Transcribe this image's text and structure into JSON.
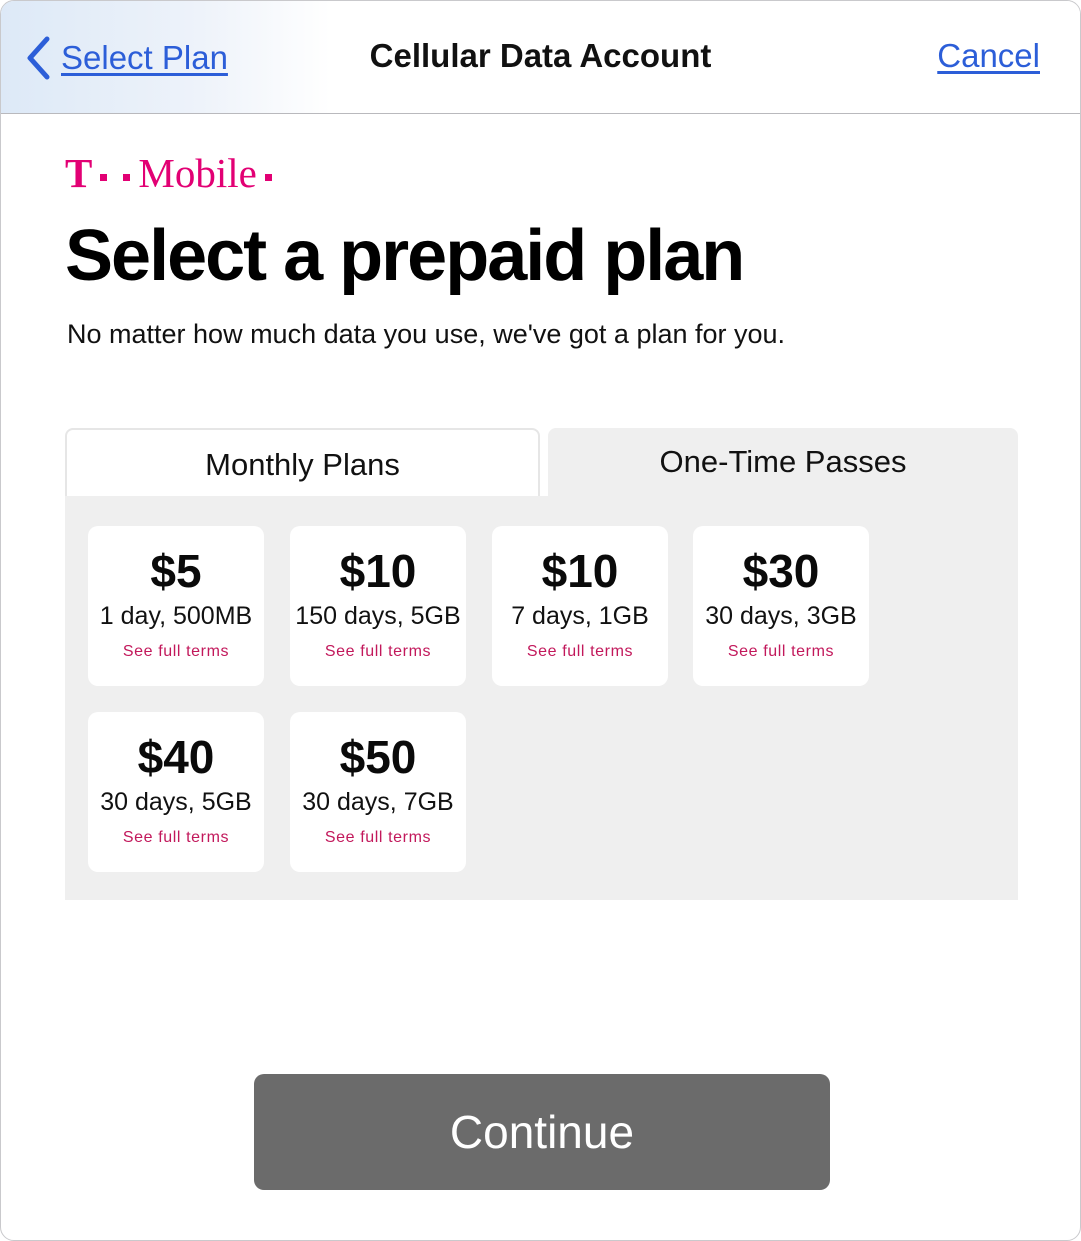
{
  "navbar": {
    "back_label": "Select Plan",
    "title": "Cellular Data Account",
    "cancel_label": "Cancel"
  },
  "brand": {
    "logo_text": "T · ·Mobile·",
    "logo_wordmark": "Mobile",
    "logo_letter": "T",
    "color": "#e20074"
  },
  "main": {
    "headline": "Select a prepaid plan",
    "subhead": "No matter how much data you use, we've got a plan for you."
  },
  "tabs": [
    {
      "label": "Monthly Plans",
      "selected": false
    },
    {
      "label": "One-Time Passes",
      "selected": true
    }
  ],
  "plans": [
    {
      "price": "$5",
      "desc": "1 day, 500MB",
      "terms": "See full terms"
    },
    {
      "price": "$10",
      "desc": "150 days, 5GB",
      "terms": "See full terms"
    },
    {
      "price": "$10",
      "desc": "7 days, 1GB",
      "terms": "See full terms"
    },
    {
      "price": "$30",
      "desc": "30 days, 3GB",
      "terms": "See full terms"
    },
    {
      "price": "$40",
      "desc": "30 days, 5GB",
      "terms": "See full terms"
    },
    {
      "price": "$50",
      "desc": "30 days, 7GB",
      "terms": "See full terms"
    }
  ],
  "footer": {
    "continue_label": "Continue"
  },
  "colors": {
    "link": "#2c5ed8",
    "accent": "#e20074",
    "panel": "#efefef",
    "button": "#6b6b6b"
  }
}
